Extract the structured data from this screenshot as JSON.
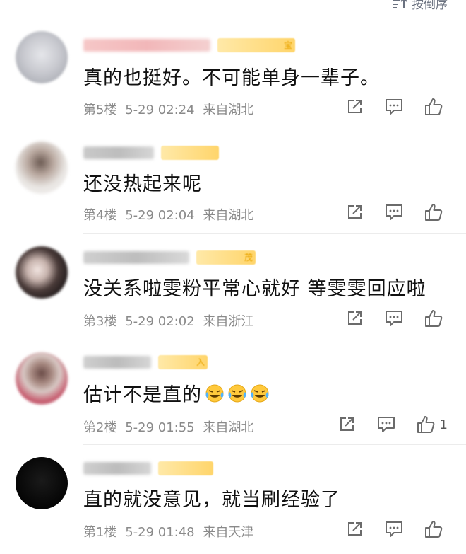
{
  "header": {
    "sort_label": "按倒序"
  },
  "colors": {
    "meta": "#8a8a8a",
    "icon": "#6b6b6b",
    "badge": "#ffd56b"
  },
  "comments": [
    {
      "badge_text": "宝",
      "content": "真的也挺好。不可能单身一辈子。",
      "floor": "第5楼",
      "date": "5-29 02:24",
      "location": "来自湖北",
      "likes": ""
    },
    {
      "badge_text": "",
      "content": "还没热起来呢",
      "floor": "第4楼",
      "date": "5-29 02:04",
      "location": "来自湖北",
      "likes": ""
    },
    {
      "badge_text": "茂",
      "content": "没关系啦雯粉平常心就好 等雯雯回应啦",
      "floor": "第3楼",
      "date": "5-29 02:02",
      "location": "来自浙江",
      "likes": ""
    },
    {
      "badge_text": "入",
      "content": "估计不是直的",
      "floor": "第2楼",
      "date": "5-29 01:55",
      "location": "来自湖北",
      "likes": "1",
      "emojis": [
        "laugh-cry-emoji",
        "laugh-cry-emoji",
        "laugh-cry-emoji"
      ]
    },
    {
      "badge_text": "",
      "content": "直的就没意见，就当刷经验了",
      "floor": "第1楼",
      "date": "5-29 01:48",
      "location": "来自天津",
      "likes": ""
    }
  ]
}
